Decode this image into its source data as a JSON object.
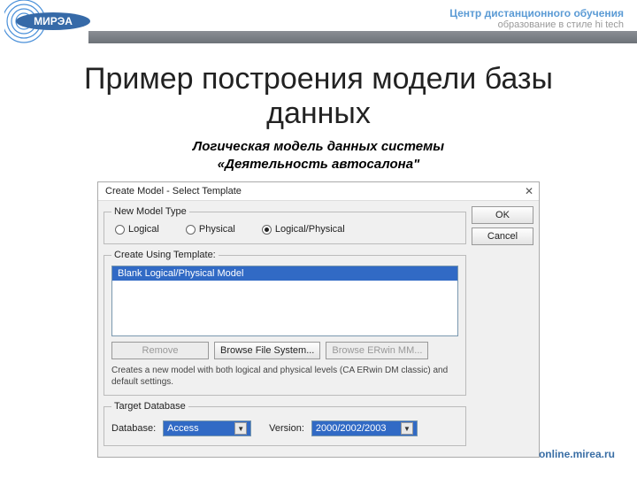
{
  "header": {
    "line1": "Центр дистанционного обучения",
    "line2": "образование в стиле hi tech",
    "logo_text": "МИРЭА"
  },
  "title": "Пример построения модели базы данных",
  "subtitle_line1": "Логическая модель данных системы",
  "subtitle_line2": "«Деятельность автосалона\"",
  "dialog": {
    "title": "Create Model - Select Template",
    "close": "✕",
    "group_model_type": "New Model Type",
    "radios": {
      "logical": "Logical",
      "physical": "Physical",
      "logical_physical": "Logical/Physical"
    },
    "group_template": "Create Using Template:",
    "template_item": "Blank Logical/Physical Model",
    "buttons": {
      "remove": "Remove",
      "browse_fs": "Browse File System...",
      "browse_mm": "Browse ERwin MM..."
    },
    "description": "Creates a new model with both logical and physical levels (CA ERwin DM classic) and default settings.",
    "group_target": "Target Database",
    "db_label": "Database:",
    "db_value": "Access",
    "version_label": "Version:",
    "version_value": "2000/2002/2003",
    "ok": "OK",
    "cancel": "Cancel"
  },
  "footer_url": "online.mirea.ru"
}
